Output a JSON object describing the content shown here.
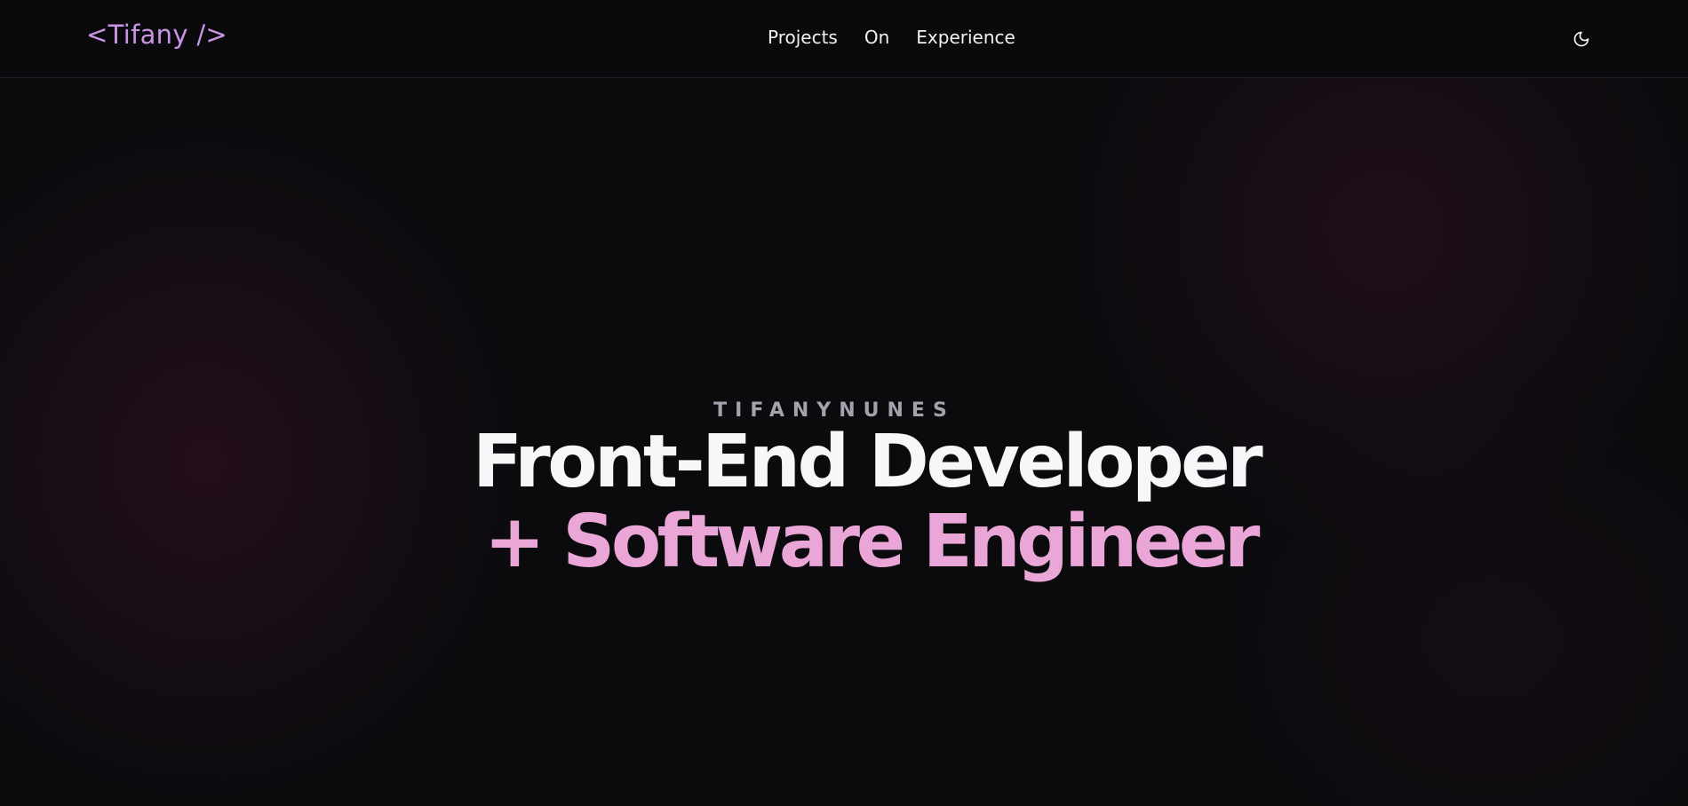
{
  "header": {
    "logo": "<Tifany />",
    "nav": [
      {
        "label": "Projects"
      },
      {
        "label": "On"
      },
      {
        "label": "Experience"
      }
    ],
    "theme_toggle_icon": "moon-icon"
  },
  "hero": {
    "eyebrow": "TIFANYNUNES",
    "title_line_1": "Front-End Developer",
    "title_line_2": "+ Software Engineer"
  },
  "colors": {
    "background": "#0b0b0e",
    "logo": "#c995e6",
    "accent_pink": "#e9a6d6",
    "text_primary": "#f7f7f9",
    "text_muted": "#a3a3ad"
  }
}
